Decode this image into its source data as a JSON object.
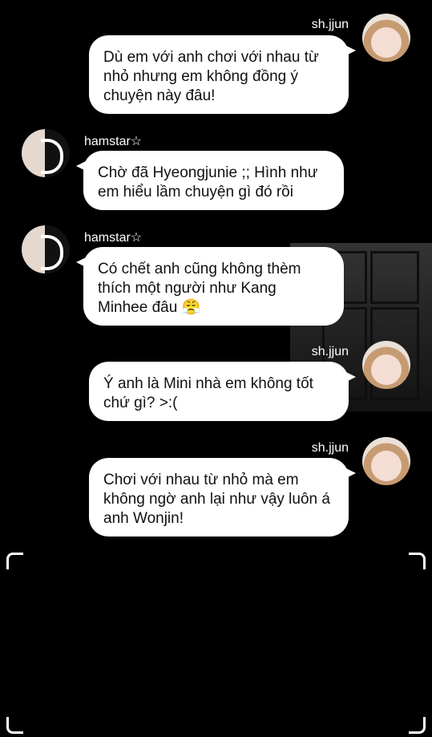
{
  "messages": [
    {
      "sender": "sh.jjun",
      "text": "Dù em với anh chơi với nhau từ nhỏ nhưng em không đồng ý chuyện này đâu!"
    },
    {
      "sender": "hamstar☆",
      "text": "Chờ đã Hyeongjunie ;; Hình như em hiểu lầm chuyện gì đó rồi"
    },
    {
      "sender": "hamstar☆",
      "text": "Có chết anh cũng không thèm thích một người như Kang Minhee đâu 😤"
    },
    {
      "sender": "sh.jjun",
      "text": "Ý anh là Mini nhà em không tốt chứ gì?  >:("
    },
    {
      "sender": "sh.jjun",
      "text": "Chơi với nhau từ nhỏ mà em không ngờ anh lại như vậy luôn á anh Wonjin!"
    }
  ]
}
